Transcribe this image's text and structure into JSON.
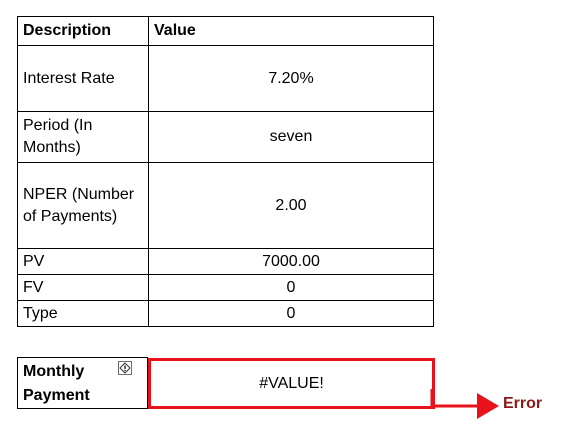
{
  "table": {
    "headers": {
      "description": "Description",
      "value": "Value"
    },
    "rows": [
      {
        "description": "Interest Rate",
        "value": "7.20%"
      },
      {
        "description": "Period (In Months)",
        "value": "seven"
      },
      {
        "description": "NPER (Number of Payments)",
        "value": "2.00"
      },
      {
        "description": "PV",
        "value": "7000.00"
      },
      {
        "description": "FV",
        "value": "0"
      },
      {
        "description": "Type",
        "value": "0"
      }
    ]
  },
  "result": {
    "label_line1": "Monthly",
    "label_line2": "Payment",
    "value": "#VALUE!",
    "highlight_color": "#e8121b"
  },
  "annotation": {
    "label": "Error",
    "color": "#8b1a1a",
    "arrow_color": "#e8121b"
  },
  "icons": {
    "cell_warning": "error-diamond-icon"
  }
}
